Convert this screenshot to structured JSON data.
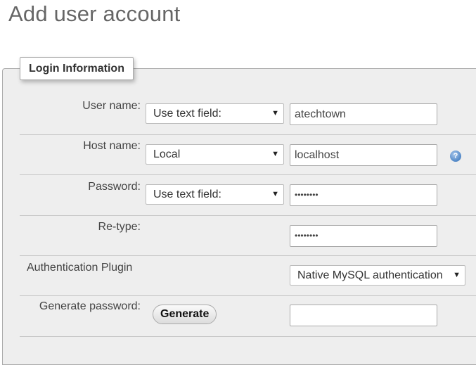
{
  "page": {
    "title": "Add user account"
  },
  "fieldset": {
    "legend": "Login Information"
  },
  "rows": {
    "username": {
      "label": "User name:",
      "select": "Use text field:",
      "value": "atechtown"
    },
    "hostname": {
      "label": "Host name:",
      "select": "Local",
      "value": "localhost",
      "help_icon": "help-icon"
    },
    "password": {
      "label": "Password:",
      "select": "Use text field:",
      "value": "••••••••"
    },
    "retype": {
      "label": "Re-type:",
      "value": "••••••••"
    },
    "auth_plugin": {
      "label": "Authentication Plugin",
      "select": "Native MySQL authentication"
    },
    "generate": {
      "label": "Generate password:",
      "button": "Generate",
      "value": ""
    }
  },
  "icons": {
    "dropdown": "▼",
    "help": "?"
  }
}
